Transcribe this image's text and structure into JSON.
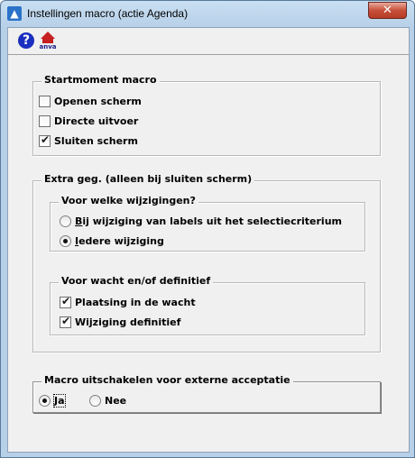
{
  "window": {
    "title": "Instellingen macro (actie Agenda)",
    "close_label": "✕"
  },
  "toolbar": {
    "help_label": "?",
    "anva_label": "anva"
  },
  "startmoment": {
    "legend": "Startmoment macro",
    "options": [
      {
        "label": "Openen scherm",
        "checked": false
      },
      {
        "label": "Directe uitvoer",
        "checked": false
      },
      {
        "label": "Sluiten scherm",
        "checked": true
      }
    ]
  },
  "extra": {
    "legend": "Extra geg. (alleen bij sluiten scherm)",
    "wijzigingen": {
      "legend": "Voor welke wijzigingen?",
      "options": [
        {
          "mnemonic": "B",
          "rest": "ij wijziging van labels uit het selectiecriterium",
          "checked": false
        },
        {
          "mnemonic": "I",
          "rest": "edere wijziging",
          "checked": true
        }
      ]
    },
    "wacht": {
      "legend": "Voor wacht en/of definitief",
      "options": [
        {
          "label": "Plaatsing in de wacht",
          "checked": true
        },
        {
          "label": "Wijziging definitief",
          "checked": true
        }
      ]
    }
  },
  "acceptatie": {
    "legend": "Macro uitschakelen voor externe acceptatie",
    "options": [
      {
        "label": "Ja",
        "checked": true
      },
      {
        "label": "Nee",
        "checked": false
      }
    ]
  }
}
